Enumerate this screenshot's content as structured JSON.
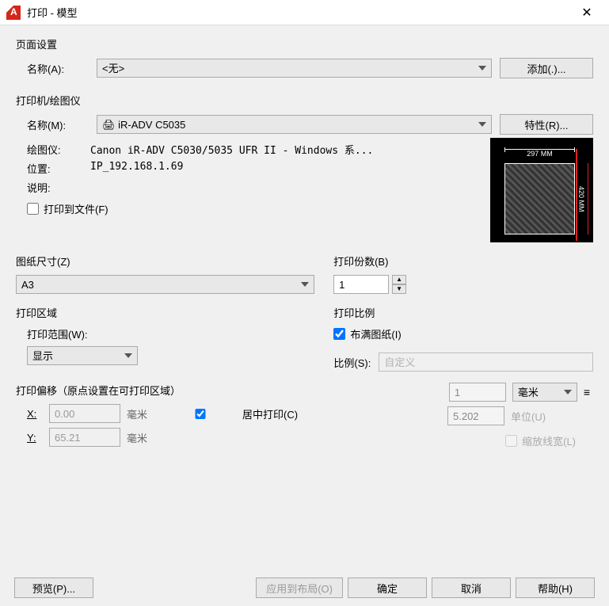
{
  "window": {
    "title": "打印 - 模型"
  },
  "page_setup": {
    "title": "页面设置",
    "name_label": "名称(A):",
    "name_value": "<无>",
    "add_button": "添加(.)..."
  },
  "printer": {
    "title": "打印机/绘图仪",
    "name_label": "名称(M):",
    "name_value": "iR-ADV C5035",
    "props_button": "特性(R)...",
    "plotter_label": "绘图仪:",
    "plotter_value": "Canon iR-ADV C5030/5035 UFR II - Windows 系...",
    "location_label": "位置:",
    "location_value": "IP_192.168.1.69",
    "desc_label": "说明:",
    "desc_value": "",
    "to_file_label": "打印到文件(F)",
    "preview_top": "297 MM",
    "preview_right": "420 MM"
  },
  "paper": {
    "title": "图纸尺寸(Z)",
    "value": "A3"
  },
  "copies": {
    "title": "打印份数(B)",
    "value": "1"
  },
  "area": {
    "title": "打印区域",
    "range_label": "打印范围(W):",
    "range_value": "显示"
  },
  "offset": {
    "title": "打印偏移（原点设置在可打印区域）",
    "x_label": "X:",
    "x_value": "0.00",
    "y_label": "Y:",
    "y_value": "65.21",
    "unit": "毫米",
    "center_label": "居中打印(C)"
  },
  "scale": {
    "title": "打印比例",
    "fit_label": "布满图纸(I)",
    "ratio_label": "比例(S):",
    "ratio_value": "自定义",
    "num_value": "1",
    "unit_value": "毫米",
    "denom_value": "5.202",
    "unit_label": "单位(U)",
    "lineweight_label": "缩放线宽(L)"
  },
  "footer": {
    "preview": "预览(P)...",
    "apply": "应用到布局(O)",
    "ok": "确定",
    "cancel": "取消",
    "help": "帮助(H)"
  }
}
